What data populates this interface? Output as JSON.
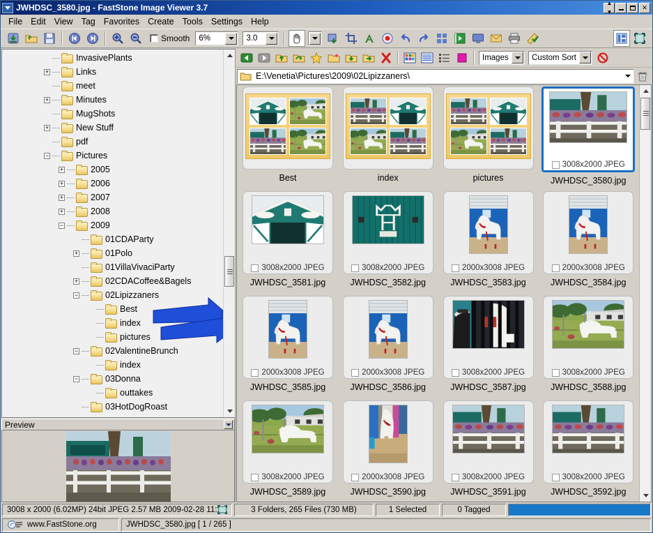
{
  "window": {
    "title": "JWHDSC_3580.jpg  -  FastStone Image Viewer 3.7",
    "sysmenu_icon": "window-menu-icon",
    "buttons": {
      "rollup": "rollup-button",
      "minimize": "minimize-button",
      "maximize": "maximize-button",
      "close": "close-button"
    }
  },
  "menubar": {
    "items": [
      "File",
      "Edit",
      "View",
      "Tag",
      "Favorites",
      "Create",
      "Tools",
      "Settings",
      "Help"
    ]
  },
  "toolbar": {
    "icons_left": [
      "download-icon",
      "open-folder-icon",
      "save-icon",
      "previous-image-icon",
      "next-image-icon",
      "zoom-in-icon",
      "zoom-out-icon"
    ],
    "smooth_label": "Smooth",
    "smooth_checked": false,
    "zoom_combo": "6%",
    "gamma_combo": "3.0",
    "icons_right": [
      "pan-hand-icon",
      "pan-dropdown-icon",
      "resize-icon",
      "crop-icon",
      "draw-text-icon",
      "red-eye-icon",
      "undo-icon",
      "redo-icon",
      "compare-icon",
      "slideshow-icon",
      "screen-icon",
      "email-icon",
      "print-icon",
      "wand-icon"
    ],
    "icons_far_right": [
      "layout-toggle-icon",
      "fullscreen-icon"
    ]
  },
  "browser_toolbar": {
    "icons": [
      "back-icon",
      "forward-icon",
      "up-folder-icon",
      "refresh-icon",
      "favorite-star-icon",
      "new-folder-icon",
      "copy-to-icon",
      "move-to-icon",
      "delete-icon",
      "thumbnail-view-icon",
      "list-view-icon",
      "detail-view-icon",
      "tag-color-icon"
    ],
    "filter_combo": "Images",
    "sort_combo": "Custom Sort",
    "stop_icon": "no-entry-icon",
    "trash_icon": "trash-icon"
  },
  "address": {
    "folder_icon": "folder-icon",
    "path": "E:\\Venetia\\Pictures\\2009\\02Lipizzaners\\",
    "dropdown_icon": "chevron-down-icon"
  },
  "tree": {
    "scrollbar": {
      "up": "scroll-up-arrow",
      "down": "scroll-down-arrow"
    },
    "items": [
      {
        "label": "InvasivePlants",
        "depth": 1,
        "expander": "none"
      },
      {
        "label": "Links",
        "depth": 1,
        "expander": "plus"
      },
      {
        "label": "meet",
        "depth": 1,
        "expander": "none"
      },
      {
        "label": "Minutes",
        "depth": 1,
        "expander": "plus"
      },
      {
        "label": "MugShots",
        "depth": 1,
        "expander": "none"
      },
      {
        "label": "New Stuff",
        "depth": 1,
        "expander": "plus"
      },
      {
        "label": "pdf",
        "depth": 1,
        "expander": "none"
      },
      {
        "label": "Pictures",
        "depth": 1,
        "expander": "minus"
      },
      {
        "label": "2005",
        "depth": 2,
        "expander": "plus"
      },
      {
        "label": "2006",
        "depth": 2,
        "expander": "plus"
      },
      {
        "label": "2007",
        "depth": 2,
        "expander": "plus"
      },
      {
        "label": "2008",
        "depth": 2,
        "expander": "plus"
      },
      {
        "label": "2009",
        "depth": 2,
        "expander": "minus"
      },
      {
        "label": "01CDAParty",
        "depth": 3,
        "expander": "none"
      },
      {
        "label": "01Polo",
        "depth": 3,
        "expander": "plus"
      },
      {
        "label": "01VillaVivaciParty",
        "depth": 3,
        "expander": "none"
      },
      {
        "label": "02CDACoffee&Bagels",
        "depth": 3,
        "expander": "plus"
      },
      {
        "label": "02Lipizzaners",
        "depth": 3,
        "expander": "minus"
      },
      {
        "label": "Best",
        "depth": 4,
        "expander": "none"
      },
      {
        "label": "index",
        "depth": 4,
        "expander": "none"
      },
      {
        "label": "pictures",
        "depth": 4,
        "expander": "none"
      },
      {
        "label": "02ValentineBrunch",
        "depth": 3,
        "expander": "minus"
      },
      {
        "label": "index",
        "depth": 4,
        "expander": "none"
      },
      {
        "label": "03Donna",
        "depth": 3,
        "expander": "minus"
      },
      {
        "label": "outtakes",
        "depth": 4,
        "expander": "none"
      },
      {
        "label": "03HotDogRoast",
        "depth": 3,
        "expander": "none"
      }
    ]
  },
  "annotations": {
    "arrow_color": "#1f4fd8",
    "arrows": [
      "pointer-arrow-upper",
      "pointer-arrow-lower"
    ]
  },
  "preview": {
    "title": "Preview",
    "collapse_icon": "collapse-icon",
    "image": "fairground-fence-crowd"
  },
  "thumbnails": {
    "items": [
      {
        "name": "Best",
        "kind": "folder",
        "meta": "",
        "selected": false
      },
      {
        "name": "index",
        "kind": "folder",
        "meta": "",
        "selected": false
      },
      {
        "name": "pictures",
        "kind": "folder",
        "meta": "",
        "selected": false
      },
      {
        "name": "JWHDSC_3580.jpg",
        "kind": "image",
        "meta": "3008x2000 JPEG",
        "orient": "land",
        "selected": true,
        "art": "crowd-fence"
      },
      {
        "name": "JWHDSC_3581.jpg",
        "kind": "image",
        "meta": "3008x2000 JPEG",
        "orient": "land",
        "selected": false,
        "art": "barn-teal"
      },
      {
        "name": "JWHDSC_3582.jpg",
        "kind": "image",
        "meta": "3008x2000 JPEG",
        "orient": "land",
        "selected": false,
        "art": "sign-teal"
      },
      {
        "name": "JWHDSC_3583.jpg",
        "kind": "image",
        "meta": "2000x3008 JPEG",
        "orient": "port",
        "selected": false,
        "art": "horse-blue"
      },
      {
        "name": "JWHDSC_3584.jpg",
        "kind": "image",
        "meta": "2000x3008 JPEG",
        "orient": "port",
        "selected": false,
        "art": "horse-blue"
      },
      {
        "name": "JWHDSC_3585.jpg",
        "kind": "image",
        "meta": "2000x3008 JPEG",
        "orient": "port",
        "selected": false,
        "art": "horse-blue"
      },
      {
        "name": "JWHDSC_3586.jpg",
        "kind": "image",
        "meta": "2000x3008 JPEG",
        "orient": "port",
        "selected": false,
        "art": "horse-blue"
      },
      {
        "name": "JWHDSC_3587.jpg",
        "kind": "image",
        "meta": "3008x2000 JPEG",
        "orient": "land",
        "selected": false,
        "art": "stall-bars"
      },
      {
        "name": "JWHDSC_3588.jpg",
        "kind": "image",
        "meta": "3008x2000 JPEG",
        "orient": "land",
        "selected": false,
        "art": "paddock"
      },
      {
        "name": "JWHDSC_3589.jpg",
        "kind": "image",
        "meta": "3008x2000 JPEG",
        "orient": "land",
        "selected": false,
        "art": "paddock"
      },
      {
        "name": "JWHDSC_3590.jpg",
        "kind": "image",
        "meta": "2000x3008 JPEG",
        "orient": "port",
        "selected": false,
        "art": "horse-stall"
      },
      {
        "name": "JWHDSC_3591.jpg",
        "kind": "image",
        "meta": "3008x2000 JPEG",
        "orient": "land",
        "selected": false,
        "art": "crowd-fence"
      },
      {
        "name": "JWHDSC_3592.jpg",
        "kind": "image",
        "meta": "3008x2000 JPEG",
        "orient": "land",
        "selected": false,
        "art": "crowd-fence"
      }
    ],
    "scrollbar": {
      "up": "scroll-up-arrow",
      "down": "scroll-down-arrow"
    }
  },
  "statusbar": {
    "file_info": "3008 x 2000 (6.02MP)   24bit JPEG   2.57 MB   2009-02-28 11:",
    "fit_icon": "fit-screen-icon",
    "folder_counts": "3 Folders, 265 Files (730 MB)",
    "selected_count": "1 Selected",
    "tagged_count": "0 Tagged",
    "progress_color": "#1878c8"
  },
  "statusbar2": {
    "logo_icon": "faststone-logo-icon",
    "website": "www.FastStone.org",
    "current_file": "JWHDSC_3580.jpg [ 1 / 265 ]"
  }
}
